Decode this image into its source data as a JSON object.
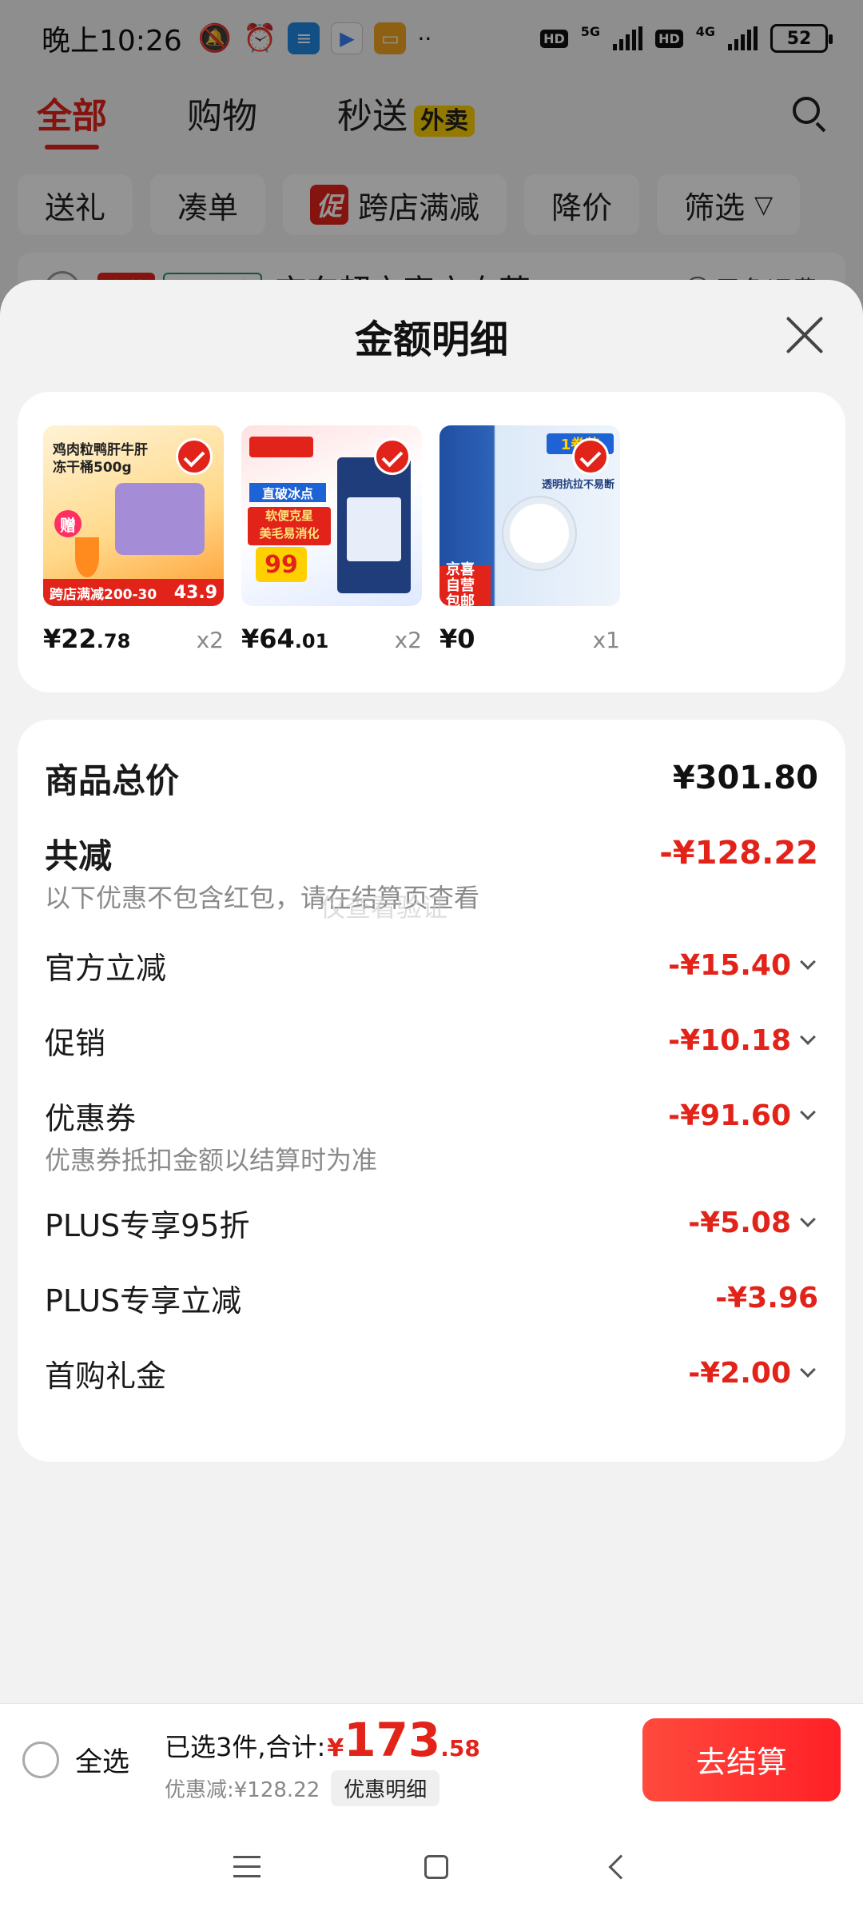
{
  "status_bar": {
    "time": "晚上10:26",
    "network_1": "5G",
    "network_2": "4G",
    "hd": "HD",
    "battery": "52"
  },
  "top_tabs": [
    {
      "label": "全部",
      "active": true
    },
    {
      "label": "购物",
      "active": false
    },
    {
      "label": "秒送",
      "active": false,
      "badge": "外卖"
    }
  ],
  "filters": {
    "items": [
      "送礼",
      "凑单",
      "跨店满减",
      "降价",
      "筛选"
    ],
    "promo_mark": "促"
  },
  "store": {
    "tag_self": "自营",
    "tag_market": "京东超市",
    "name": "京东超市官方自营",
    "shipping": "已免运费"
  },
  "sheet": {
    "title": "金额明细"
  },
  "products": [
    {
      "price_int": "¥22",
      "price_dec": ".78",
      "qty": "x2",
      "img_text": "鸡肉粒鸭肝牛肝\n冻干桶500g",
      "img_badge": "赠",
      "banner": "跨店满减200-30",
      "banner_price": "43.9"
    },
    {
      "price_int": "¥64",
      "price_dec": ".01",
      "qty": "x2",
      "img_text": "软便克星\n美毛易消化",
      "img_badge": "99",
      "banner": "直破冰点",
      "banner_price": ""
    },
    {
      "price_int": "¥0",
      "price_dec": "",
      "qty": "x1",
      "img_text": "透明抗拉不易断",
      "img_badge": "1卷装",
      "banner": "京喜自营 包邮",
      "banner_price": ""
    }
  ],
  "details": {
    "total_label": "商品总价",
    "total_value": "¥301.80",
    "reduce_label": "共减",
    "reduce_value": "-¥128.22",
    "reduce_note": "以下优惠不包含红包，请在结算页查看",
    "watermark": "仅查看验证",
    "rows": [
      {
        "label": "官方立减",
        "value": "-¥15.40",
        "expandable": true
      },
      {
        "label": "促销",
        "value": "-¥10.18",
        "expandable": true
      },
      {
        "label": "优惠券",
        "value": "-¥91.60",
        "expandable": true,
        "note": "优惠券抵扣金额以结算时为准"
      },
      {
        "label": "PLUS专享95折",
        "value": "-¥5.08",
        "expandable": true
      },
      {
        "label": "PLUS专享立减",
        "value": "-¥3.96",
        "expandable": false
      },
      {
        "label": "首购礼金",
        "value": "-¥2.00",
        "expandable": true
      }
    ]
  },
  "checkout": {
    "select_all": "全选",
    "selected_text": "已选3件,合计:",
    "currency": "¥",
    "total_int": "173",
    "total_dec": ".58",
    "discount_text": "优惠减:¥128.22",
    "detail_button": "优惠明细",
    "checkout_button": "去结算"
  },
  "colors": {
    "accent": "#e2231a",
    "checkout_gradient_start": "#ff4a3d",
    "checkout_gradient_end": "#ff2026",
    "badge_yellow": "#ffd000"
  }
}
